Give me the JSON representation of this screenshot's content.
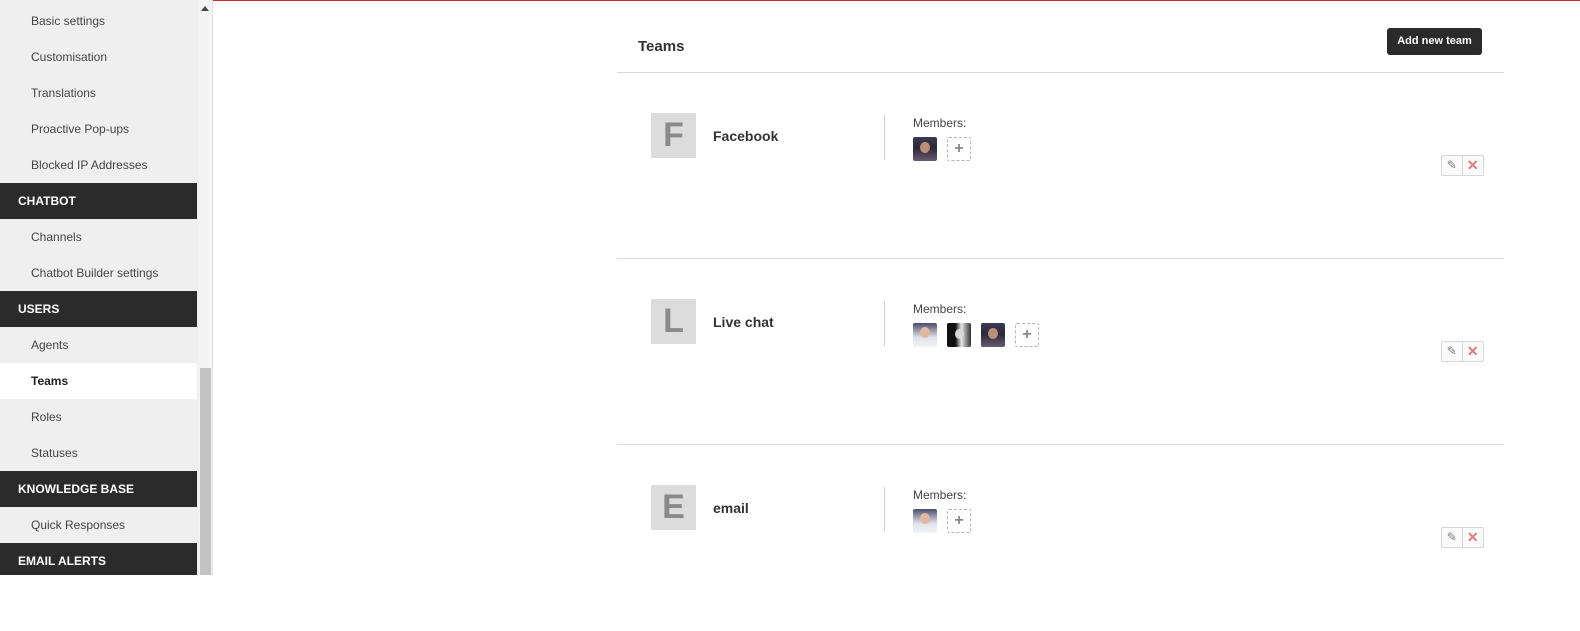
{
  "sidebar": {
    "groups": [
      {
        "items": [
          "Basic settings",
          "Customisation",
          "Translations",
          "Proactive Pop-ups",
          "Blocked IP Addresses"
        ]
      },
      {
        "section": "CHATBOT",
        "items": [
          "Channels",
          "Chatbot Builder settings"
        ]
      },
      {
        "section": "USERS",
        "items": [
          "Agents",
          "Teams",
          "Roles",
          "Statuses"
        ]
      },
      {
        "section": "KNOWLEDGE BASE",
        "items": [
          "Quick Responses"
        ]
      },
      {
        "section": "EMAIL ALERTS",
        "items": []
      }
    ],
    "active_item": "Teams"
  },
  "header": {
    "title": "Teams",
    "add_button": "Add new team"
  },
  "teams": [
    {
      "letter": "F",
      "name": "Facebook",
      "members_label": "Members:",
      "members": [
        "avatar-woman-dark"
      ]
    },
    {
      "letter": "L",
      "name": "Live chat",
      "members_label": "Members:",
      "members": [
        "avatar-man-light",
        "avatar-bw",
        "avatar-woman-dark"
      ]
    },
    {
      "letter": "E",
      "name": "email",
      "members_label": "Members:",
      "members": [
        "avatar-man-light"
      ]
    }
  ],
  "icons": {
    "add_member": "plus-icon",
    "edit": "pencil-icon",
    "delete": "close-icon"
  },
  "colors": {
    "accent_line": "#c9302c",
    "section_bg": "#2b2b2b",
    "button_bg": "#2b2b2b"
  }
}
